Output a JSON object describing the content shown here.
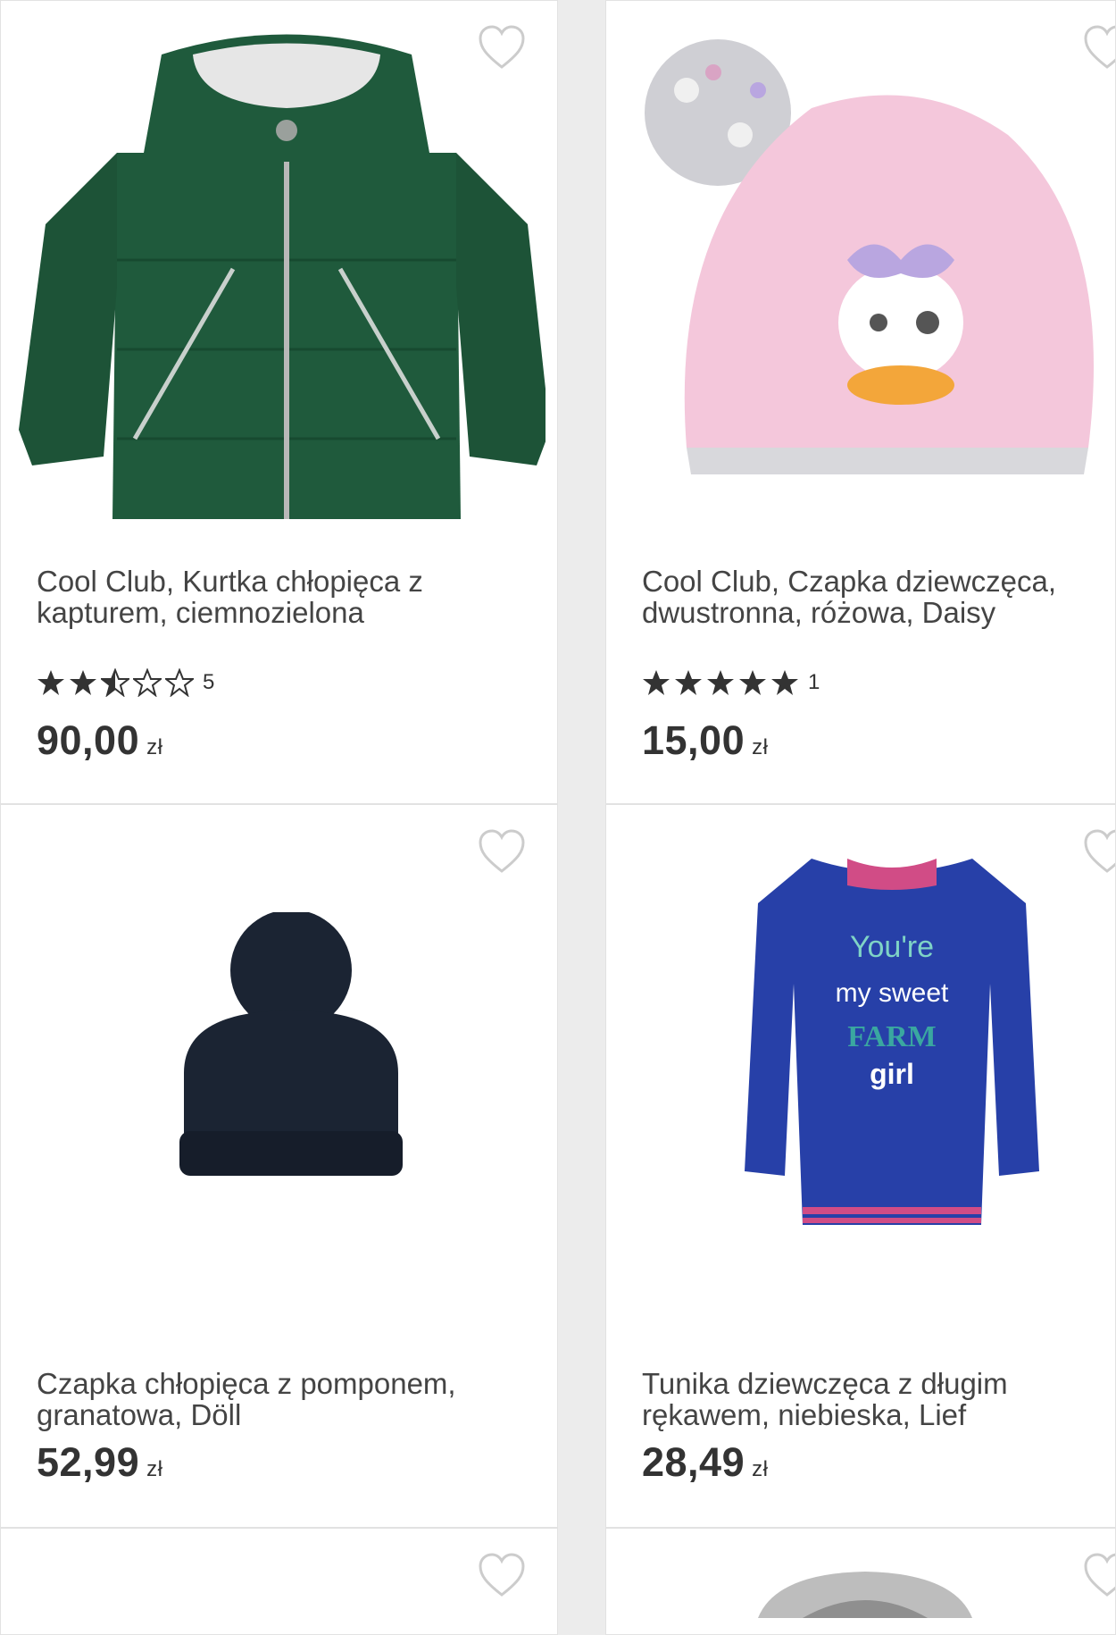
{
  "products": [
    {
      "title_line1": "Cool Club, Kurtka chłopięca z",
      "title_line2": "kapturem, ciemnozielona",
      "rating": 2.5,
      "review_count": "5",
      "price": "90,00",
      "currency": "zł",
      "image": "green-hooded-jacket"
    },
    {
      "title_line1": "Cool Club, Czapka dziewczęca,",
      "title_line2": "dwustronna, różowa, Daisy",
      "rating": 5,
      "review_count": "1",
      "price": "15,00",
      "currency": "zł",
      "image": "pink-daisy-duck-beanie"
    },
    {
      "title_line1": "Czapka chłopięca z pomponem,",
      "title_line2": "granatowa, Döll",
      "price": "52,99",
      "currency": "zł",
      "image": "navy-pompom-hat"
    },
    {
      "title_line1": "Tunika dziewczęca z długim",
      "title_line2": "rękawem, niebieska, Lief",
      "price": "28,49",
      "currency": "zł",
      "image": "blue-farm-girl-tunic",
      "print_text": [
        "You're",
        "my sweet",
        "FARM",
        "girl"
      ]
    },
    {
      "image": "partial-next-item"
    },
    {
      "image": "grey-hoodie-partial"
    }
  ],
  "colors": {
    "star": "#333333",
    "heart_outline": "#cccccc",
    "jacket": "#1f5a3c",
    "beanie_pink": "#f4c7db",
    "hat_navy": "#1b2433",
    "tunic_blue": "#2740a8"
  }
}
